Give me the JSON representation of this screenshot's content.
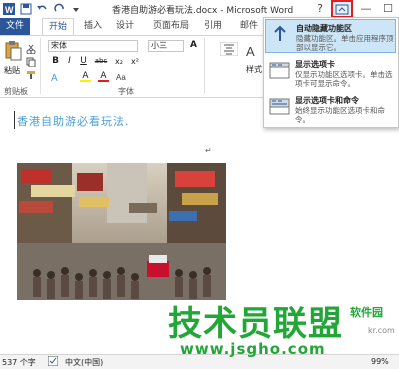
{
  "window": {
    "title": "香港自助游必看玩法.docx - Microsoft Word",
    "help": "?",
    "minimize": "—",
    "maximize": "☐",
    "close": "✕"
  },
  "tabs": [
    {
      "label": "文件"
    },
    {
      "label": "开始"
    },
    {
      "label": "插入"
    },
    {
      "label": "设计"
    },
    {
      "label": "页面布局"
    },
    {
      "label": "引用"
    },
    {
      "label": "邮件"
    }
  ],
  "ribbon": {
    "paste_label": "粘贴",
    "clipboard_label": "剪贴板",
    "font_name": "宋体",
    "font_size": "小三",
    "bold": "B",
    "italic": "I",
    "underline": "U",
    "strike": "abc",
    "subscript": "x₂",
    "superscript": "x²",
    "font_color": "A",
    "highlight": "A",
    "grow": "A",
    "font_group_label": "字体",
    "styles_label": "样式"
  },
  "ribbon_menu": {
    "items": [
      {
        "title": "自动隐藏功能区",
        "desc": "隐藏功能区。单击应用程序顶部以显示它。",
        "icon": "auto-hide-icon",
        "selected": true
      },
      {
        "title": "显示选项卡",
        "desc": "仅显示功能区选项卡。单击选项卡可显示命令。",
        "icon": "show-tabs-icon",
        "selected": false
      },
      {
        "title": "显示选项卡和命令",
        "desc": "始终显示功能区选项卡和命令。",
        "icon": "show-tabs-commands-icon",
        "selected": false
      }
    ]
  },
  "document": {
    "heading": "香港自助游必看玩法."
  },
  "statusbar": {
    "word_count": "537 个字",
    "language": "中文(中国)",
    "zoom": "99%"
  },
  "watermark": {
    "main": "技术员联盟",
    "url": "www.jsgho.com",
    "side": "软件园",
    "corner": "kr.com"
  },
  "colors": {
    "word_blue": "#2b579a",
    "heading_blue": "#4a9fd8",
    "menu_highlight": "#cde6f7",
    "watermark_green": "#22a637"
  }
}
